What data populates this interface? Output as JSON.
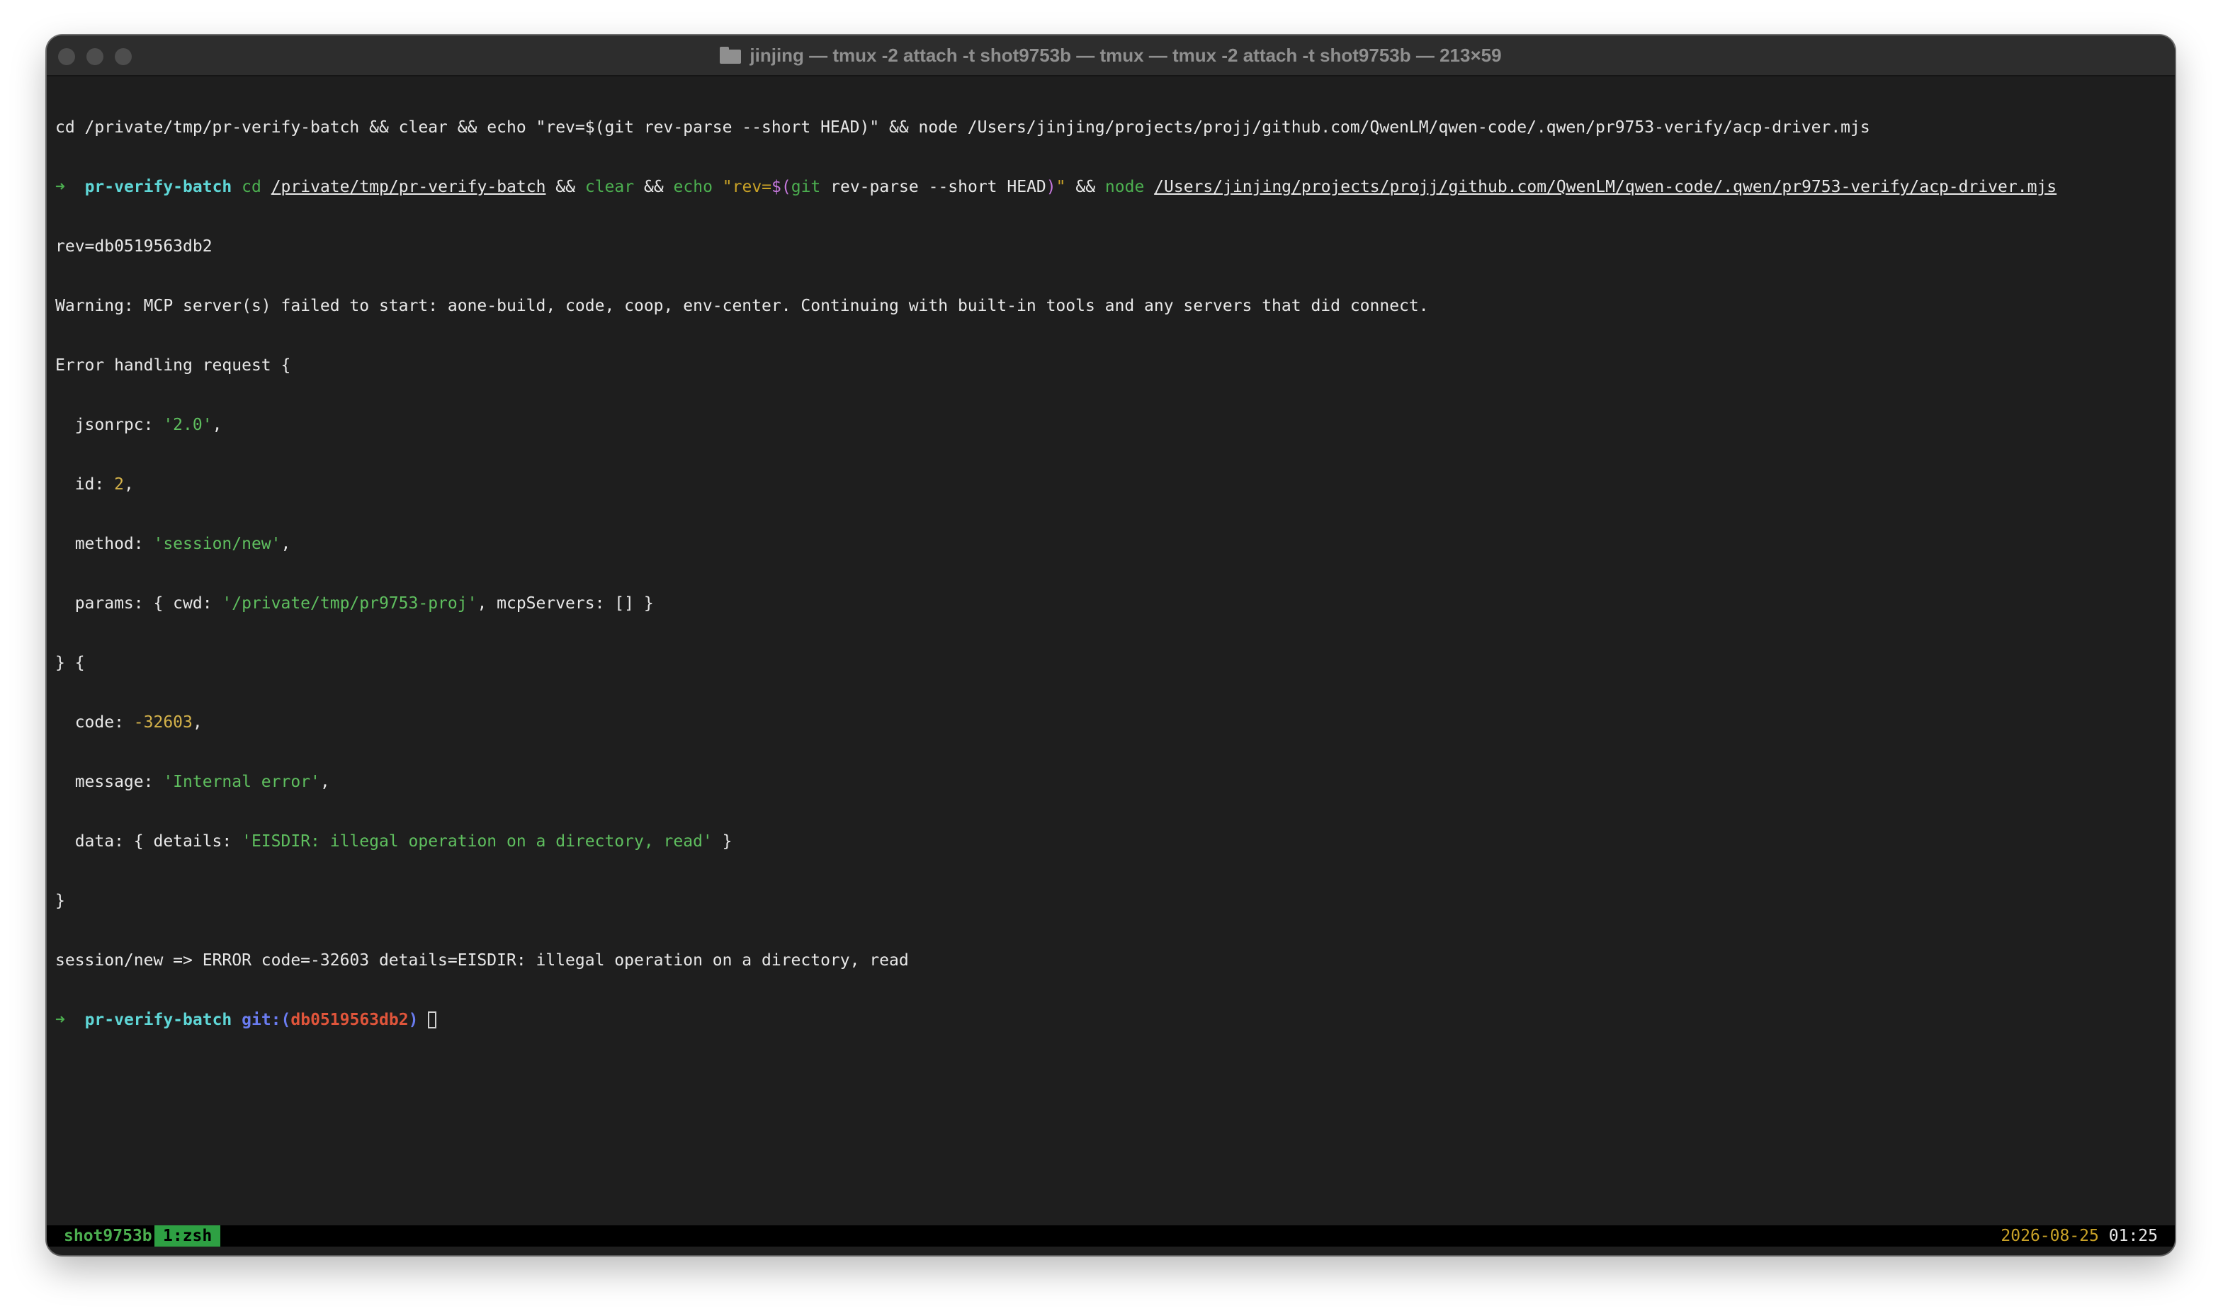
{
  "window": {
    "title": "jinjing — tmux -2 attach -t shot9753b — tmux — tmux -2 attach -t shot9753b — 213×59"
  },
  "terminal": {
    "line1": "cd /private/tmp/pr-verify-batch && clear && echo \"rev=$(git rev-parse --short HEAD)\" && node /Users/jinjing/projects/projj/github.com/QwenLM/qwen-code/.qwen/pr9753-verify/acp-driver.mjs",
    "prompt_arrow": "➜",
    "prompt_dir": "pr-verify-batch",
    "cmd_cd": "cd",
    "path_batch": "/private/tmp/pr-verify-batch",
    "op_and": "&&",
    "cmd_clear": "clear",
    "cmd_echo": "echo",
    "str_rev_open": "\"rev=",
    "subst_open": "$(",
    "cmd_git": "git",
    "git_args": " rev-parse --short HEAD",
    "subst_close": ")",
    "str_close": "\"",
    "cmd_node": "node",
    "path_driver": "/Users/jinjing/projects/projj/github.com/QwenLM/qwen-code/.qwen/pr9753-verify/acp-driver.mjs",
    "rev_line": "rev=db0519563db2",
    "warning_line": "Warning: MCP server(s) failed to start: aone-build, code, coop, env-center. Continuing with built-in tools and any servers that did connect.",
    "error_header": "Error handling request {",
    "key_jsonrpc": "  jsonrpc: ",
    "val_jsonrpc": "'2.0'",
    "key_id": "  id: ",
    "val_id": "2",
    "key_method": "  method: ",
    "val_method": "'session/new'",
    "key_params": "  params: { cwd: ",
    "val_cwd": "'/private/tmp/pr9753-proj'",
    "params_rest": ", mcpServers: [] }",
    "close_open": "} {",
    "key_code": "  code: ",
    "val_code": "-32603",
    "key_message": "  message: ",
    "val_message": "'Internal error'",
    "key_data": "  data: { details: ",
    "val_details": "'EISDIR: illegal operation on a directory, read'",
    "data_rest": " }",
    "close_brace": "}",
    "result_line": "session/new => ERROR code=-32603 details=EISDIR: illegal operation on a directory, read",
    "git_label": "git:(",
    "git_hash": "db0519563db2",
    "git_close": ")"
  },
  "statusbar": {
    "session_name": "shot9753b",
    "window_tab": "1:zsh",
    "date": "2026-08-25",
    "time": "01:25"
  }
}
